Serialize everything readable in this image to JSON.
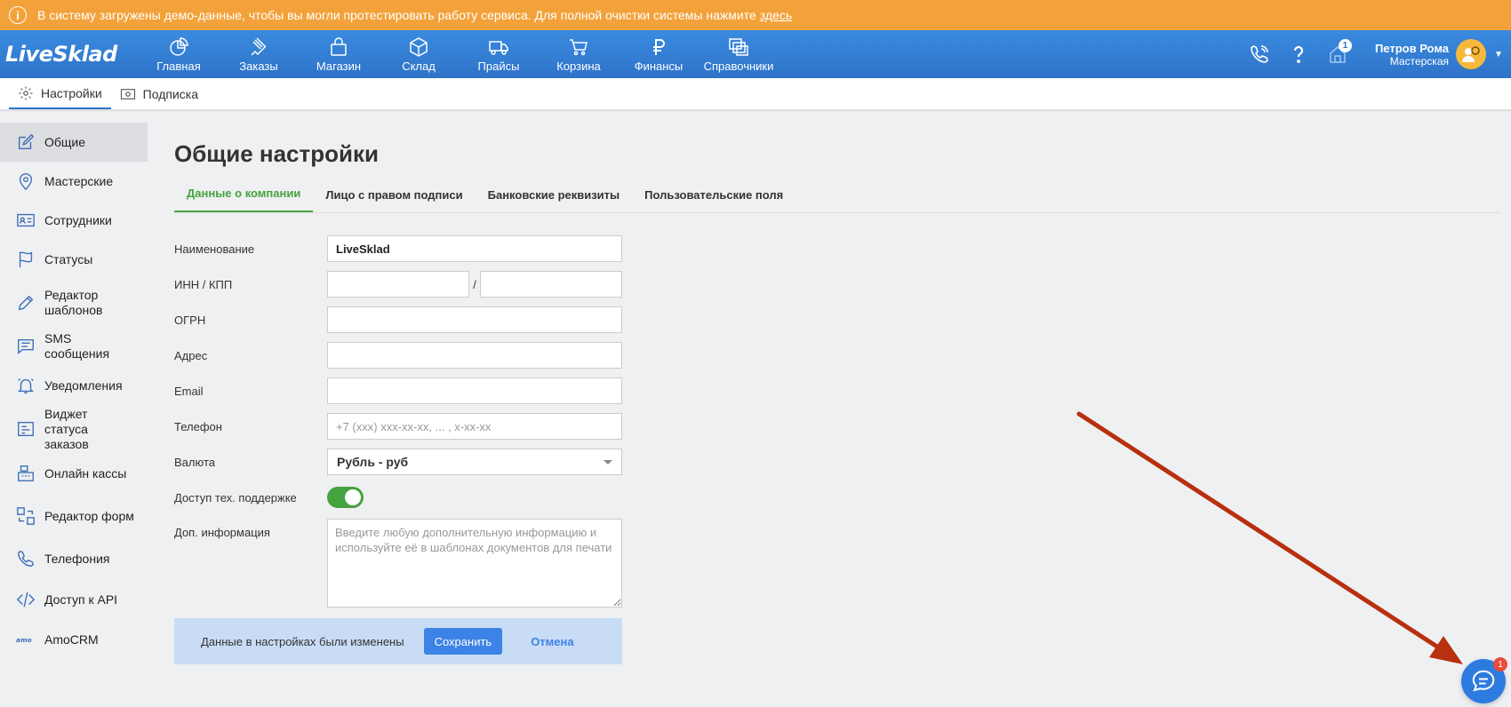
{
  "banner": {
    "text": "В систему загружены демо-данные, чтобы вы могли протестировать работу сервиса. Для полной очистки системы нажмите",
    "link": "здесь",
    "icon": "info-icon"
  },
  "app": {
    "logo": "LiveSklad"
  },
  "nav": {
    "items": [
      {
        "label": "Главная",
        "icon": "pie-chart-icon"
      },
      {
        "label": "Заказы",
        "icon": "orders-icon"
      },
      {
        "label": "Магазин",
        "icon": "shop-bag-icon"
      },
      {
        "label": "Склад",
        "icon": "box-icon"
      },
      {
        "label": "Прайсы",
        "icon": "truck-icon"
      },
      {
        "label": "Корзина",
        "icon": "cart-icon"
      },
      {
        "label": "Финансы",
        "icon": "ruble-icon"
      },
      {
        "label": "Справочники",
        "icon": "directories-icon"
      }
    ],
    "notification_count": "1"
  },
  "user": {
    "name": "Петров Рома",
    "role": "Мастерская"
  },
  "subnav": {
    "settings": "Настройки",
    "subscription": "Подписка"
  },
  "sidebar": {
    "items": [
      {
        "label": "Общие",
        "icon": "edit-icon"
      },
      {
        "label": "Мастерские",
        "icon": "location-pin-icon"
      },
      {
        "label": "Сотрудники",
        "icon": "id-card-icon"
      },
      {
        "label": "Статусы",
        "icon": "flag-icon"
      },
      {
        "label": "Редактор шаблонов",
        "icon": "pencil-icon"
      },
      {
        "label": "SMS сообщения",
        "icon": "message-icon"
      },
      {
        "label": "Уведомления",
        "icon": "bell-icon"
      },
      {
        "label": "Виджет статуса заказов",
        "icon": "widget-icon"
      },
      {
        "label": "Онлайн кассы",
        "icon": "cash-register-icon"
      },
      {
        "label": "Редактор форм",
        "icon": "form-editor-icon"
      },
      {
        "label": "Телефония",
        "icon": "phone-icon"
      },
      {
        "label": "Доступ к API",
        "icon": "code-icon"
      },
      {
        "label": "AmoCRM",
        "icon": "amocrm-logo"
      }
    ]
  },
  "page": {
    "title": "Общие настройки",
    "tabs": [
      "Данные о компании",
      "Лицо с правом подписи",
      "Банковские реквизиты",
      "Пользовательские поля"
    ]
  },
  "form": {
    "name_label": "Наименование",
    "name_value": "LiveSklad",
    "inn_label": "ИНН / КПП",
    "inn_value": "",
    "kpp_value": "",
    "slash": "/",
    "ogrn_label": "ОГРН",
    "address_label": "Адрес",
    "email_label": "Email",
    "phone_label": "Телефон",
    "phone_placeholder": "+7 (xxx) xxx-xx-xx, ... , x-xx-xx",
    "currency_label": "Валюта",
    "currency_value": "Рубль - руб",
    "support_label": "Доступ тех. поддержке",
    "support_enabled": true,
    "info_label": "Доп. информация",
    "info_placeholder": "Введите любую дополнительную информацию и используйте её в шаблонах документов для печати"
  },
  "savebar": {
    "message": "Данные в настройках были изменены",
    "save": "Сохранить",
    "cancel": "Отмена"
  },
  "chat": {
    "badge": "1"
  },
  "colors": {
    "banner": "#f3a23b",
    "nav": "#2e73c8",
    "accent_green": "#45a33f",
    "button_blue": "#3d82e6",
    "annotation_arrow": "#b8300f"
  }
}
